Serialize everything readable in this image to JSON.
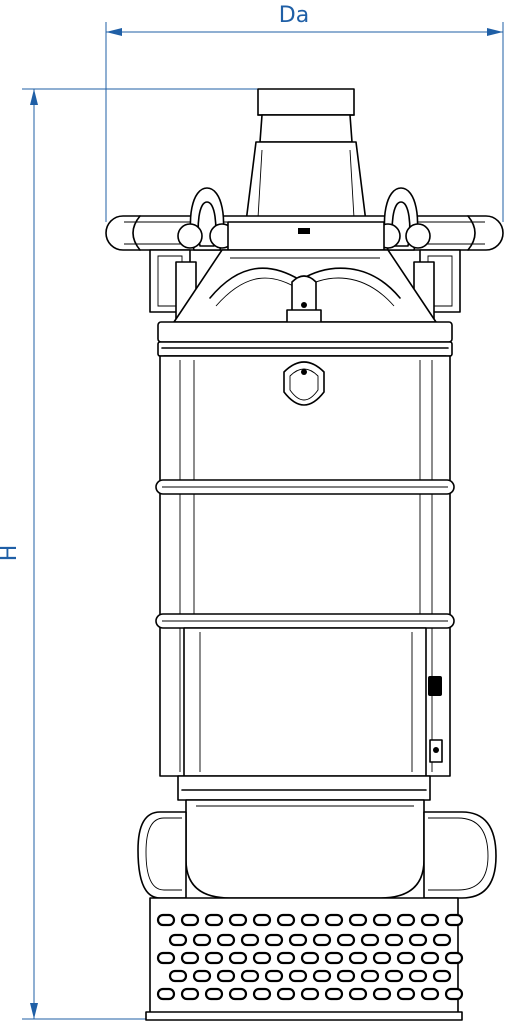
{
  "dimensions": {
    "width_label": "Da",
    "height_label": "H"
  },
  "colors": {
    "dimension": "#1f5fa6",
    "outline": "#000000",
    "background": "#ffffff"
  }
}
